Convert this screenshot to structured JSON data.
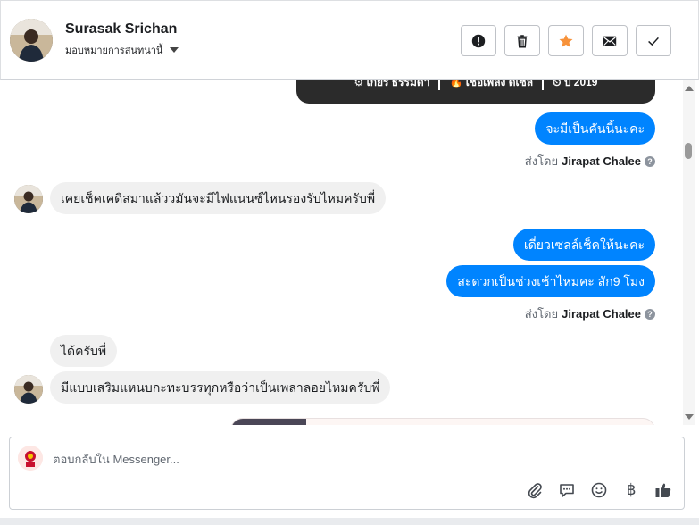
{
  "header": {
    "name": "Surasak Srichan",
    "assign_label": "มอบหมายการสนทนานี้",
    "actions": [
      {
        "icon": "alert-icon",
        "label": "spam"
      },
      {
        "icon": "trash-icon",
        "label": "delete"
      },
      {
        "icon": "star-icon",
        "label": "star",
        "color": "#f7923a"
      },
      {
        "icon": "mail-icon",
        "label": "unread"
      },
      {
        "icon": "check-icon",
        "label": "done"
      }
    ]
  },
  "card_top": {
    "specs": [
      "⚙ เกียร์ ธรรมดา",
      "🔥 เชื้อเพลิง ดีเซล",
      "⏲ ปี 2019"
    ]
  },
  "messages": {
    "m1": "จะมีเป็นคันนี้นะคะ",
    "sent_by_1_prefix": "ส่งโดย",
    "sent_by_1_name": "Jirapat Chalee",
    "m2": "เคยเช็คเคดิสมาแล้ววมันจะมีไฟแนนซ์ไหนรองรับไหมครับพี่",
    "m3": "เดี๋ยวเซลล์เช็คให้นะคะ",
    "m4": "สะดวกเป็นช่วงเช้าไหมคะ สัก9 โมง",
    "sent_by_2_prefix": "ส่งโดย",
    "sent_by_2_name": "Jirapat Chalee",
    "m5": "ได้ครับพี่",
    "m6": "มีแบบเสริมแหนบกะทะบรรทุกหรือว่าเป็นเพลาลอยไหมครับพี่"
  },
  "composer": {
    "placeholder": "ตอบกลับใน Messenger...",
    "tools": [
      "attach-icon",
      "saved-reply-icon",
      "emoji-icon",
      "baht-icon",
      "thumbs-up-icon"
    ],
    "baht_symbol": "฿"
  },
  "colors": {
    "outgoing": "#0084ff",
    "incoming": "#f0f0f0",
    "star": "#f7923a"
  }
}
